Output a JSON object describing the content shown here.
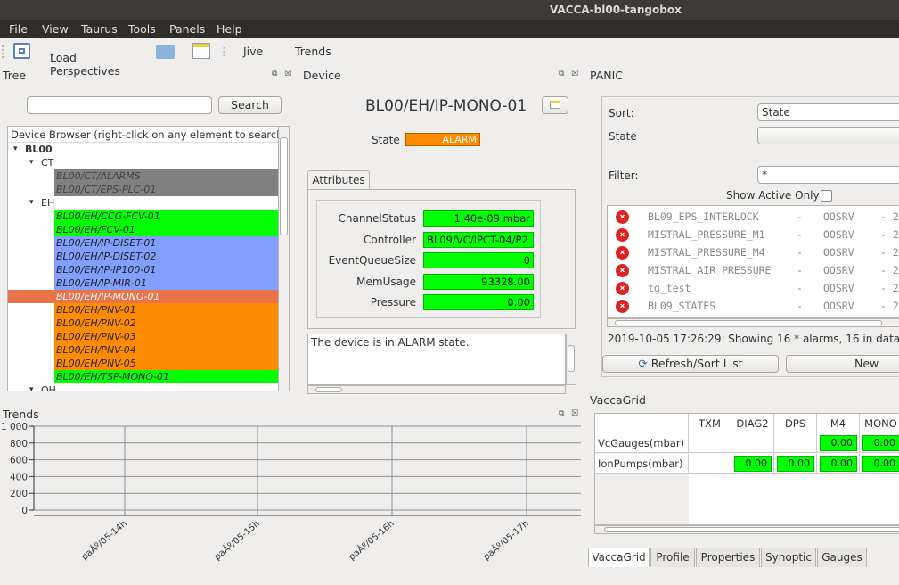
{
  "window": {
    "title": "VACCA-bl00-tangobox"
  },
  "menu": [
    "File",
    "View",
    "Taurus",
    "Tools",
    "Panels",
    "Help"
  ],
  "toolbar": {
    "load_perspectives": "Load Perspectives",
    "jive": "Jive",
    "trends": "Trends"
  },
  "tree_panel": {
    "title": "Tree",
    "search_button": "Search",
    "search_value": "",
    "header": "Device Browser (right-click on any element to search,",
    "rows": [
      {
        "label": "BL00",
        "kind": "root",
        "expanded": "▾",
        "color": "#ffffff"
      },
      {
        "label": "CT",
        "kind": "group",
        "expanded": "▾",
        "color": "#ffffff"
      },
      {
        "label": "BL00/CT/ALARMS",
        "kind": "leaf",
        "color": "#808080"
      },
      {
        "label": "BL00/CT/EPS-PLC-01",
        "kind": "leaf",
        "color": "#808080"
      },
      {
        "label": "EH",
        "kind": "group",
        "expanded": "▾",
        "color": "#ffffff"
      },
      {
        "label": "BL00/EH/CCG-FCV-01",
        "kind": "leaf",
        "color": "#00ff00"
      },
      {
        "label": "BL00/EH/FCV-01",
        "kind": "leaf",
        "color": "#00ff00"
      },
      {
        "label": "BL00/EH/IP-DISET-01",
        "kind": "leaf",
        "color": "#809fff"
      },
      {
        "label": "BL00/EH/IP-DISET-02",
        "kind": "leaf",
        "color": "#809fff"
      },
      {
        "label": "BL00/EH/IP-IP100-01",
        "kind": "leaf",
        "color": "#809fff"
      },
      {
        "label": "BL00/EH/IP-MIR-01",
        "kind": "leaf",
        "color": "#809fff"
      },
      {
        "label": "BL00/EH/IP-MONO-01",
        "kind": "leaf-selected",
        "color": "#e9744a"
      },
      {
        "label": "BL00/EH/PNV-01",
        "kind": "leaf",
        "color": "#ff8c00"
      },
      {
        "label": "BL00/EH/PNV-02",
        "kind": "leaf",
        "color": "#ff8c00"
      },
      {
        "label": "BL00/EH/PNV-03",
        "kind": "leaf",
        "color": "#ff8c00"
      },
      {
        "label": "BL00/EH/PNV-04",
        "kind": "leaf",
        "color": "#ff8c00"
      },
      {
        "label": "BL00/EH/PNV-05",
        "kind": "leaf",
        "color": "#ff8c00"
      },
      {
        "label": "BL00/EH/TSP-MONO-01",
        "kind": "leaf",
        "color": "#00ff00"
      },
      {
        "label": "OH",
        "kind": "group",
        "expanded": "▾",
        "color": "#ffffff"
      }
    ]
  },
  "device_panel": {
    "title": "Device",
    "device_name": "BL00/EH/IP-MONO-01",
    "state_label": "State",
    "state_value": "ALARM",
    "attributes_tab": "Attributes",
    "attributes": [
      {
        "name": "ChannelStatus",
        "value": "1.40e-09 mbar",
        "align": "right"
      },
      {
        "name": "Controller",
        "value": "BL09/VC/IPCT-04/P2",
        "align": "left"
      },
      {
        "name": "EventQueueSize",
        "value": "0",
        "align": "right"
      },
      {
        "name": "MemUsage",
        "value": "93328.00",
        "align": "right"
      },
      {
        "name": "Pressure",
        "value": "0.00",
        "align": "right"
      }
    ],
    "status_text": "The device is in ALARM state."
  },
  "panic_panel": {
    "title": "PANIC",
    "sort_label": "Sort:",
    "sort_value": "State",
    "state_label": "State",
    "filter_label": "Filter:",
    "filter_value": "*",
    "show_active_only": "Show Active Only",
    "alarms": [
      {
        "name": "BL09_EPS_INTERLOCK",
        "dash": "-",
        "status": "OOSRV",
        "tail": "- 2"
      },
      {
        "name": "MISTRAL_PRESSURE_M1",
        "dash": "-",
        "status": "OOSRV",
        "tail": "- 2"
      },
      {
        "name": "MISTRAL_PRESSURE_M4",
        "dash": "-",
        "status": "OOSRV",
        "tail": "- 2"
      },
      {
        "name": "MISTRAL_AIR_PRESSURE",
        "dash": "-",
        "status": "OOSRV",
        "tail": "- 2"
      },
      {
        "name": "tg_test",
        "dash": "-",
        "status": "OOSRV",
        "tail": "- 2"
      },
      {
        "name": "BL09_STATES",
        "dash": "-",
        "status": "OOSRV",
        "tail": "- 2"
      }
    ],
    "summary": "2019-10-05 17:26:29: Showing 16 * alarms, 16 in database.",
    "refresh_button": "Refresh/Sort List",
    "new_button": "New"
  },
  "vaccagrid": {
    "title": "VaccaGrid",
    "columns": [
      "TXM",
      "DIAG2",
      "DPS",
      "M4",
      "MONO"
    ],
    "rows": [
      {
        "label": "VcGauges(mbar)",
        "values": [
          "",
          "",
          "",
          "0.00",
          "0.00"
        ]
      },
      {
        "label": "IonPumps(mbar)",
        "values": [
          "",
          "0.00",
          "0.00",
          "0.00",
          "0.00"
        ]
      }
    ],
    "tabs": [
      "VaccaGrid",
      "Profile",
      "Properties",
      "Synoptic",
      "Gauges"
    ]
  },
  "trends_panel": {
    "title": "Trends",
    "y_ticks": [
      "1 000",
      "800",
      "600",
      "400",
      "200",
      "0"
    ],
    "x_ticks": [
      "paÂº/05-14h",
      "paÂº/05-15h",
      "paÂº/05-16h",
      "paÂº/05-17h"
    ]
  },
  "colors": {
    "alarm": "#ff8c00",
    "valid": "#00ff00",
    "selected": "#e9744a",
    "disabled": "#808080",
    "moving": "#809fff"
  }
}
